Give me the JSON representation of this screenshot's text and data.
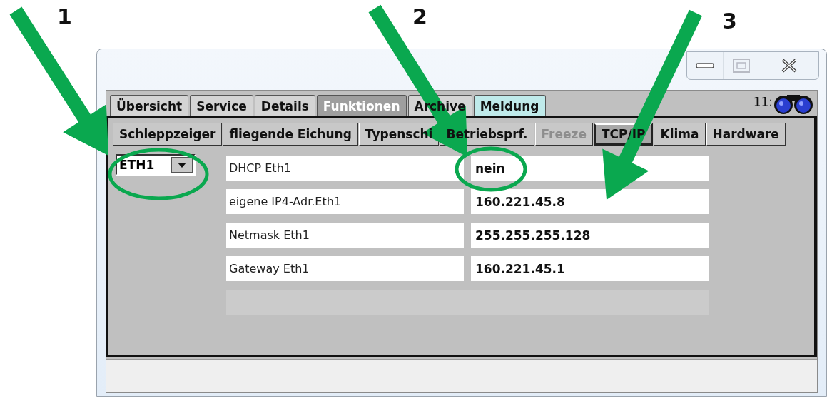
{
  "annotations": [
    {
      "label": "1"
    },
    {
      "label": "2"
    },
    {
      "label": "3"
    }
  ],
  "window": {
    "buttons": [
      {
        "kind": "minimize",
        "disabled": false
      },
      {
        "kind": "maximize",
        "disabled": true
      },
      {
        "kind": "close",
        "disabled": false
      }
    ]
  },
  "tabs": [
    {
      "label": "Übersicht",
      "selected": false,
      "highlighted": false
    },
    {
      "label": "Service",
      "selected": false,
      "highlighted": false
    },
    {
      "label": "Details",
      "selected": false,
      "highlighted": false
    },
    {
      "label": "Funktionen",
      "selected": true,
      "highlighted": false
    },
    {
      "label": "Archive",
      "selected": false,
      "highlighted": false
    },
    {
      "label": "Meldung",
      "selected": false,
      "highlighted": true
    }
  ],
  "clock": "11:",
  "subtabs": [
    {
      "label": "Schleppzeiger",
      "selected": false,
      "disabled": false
    },
    {
      "label": "fliegende Eichung",
      "selected": false,
      "disabled": false
    },
    {
      "label": "Typenschi",
      "selected": false,
      "disabled": false
    },
    {
      "label": "Betriebsprf.",
      "selected": false,
      "disabled": false
    },
    {
      "label": "Freeze",
      "selected": false,
      "disabled": true
    },
    {
      "label": "TCP/IP",
      "selected": true,
      "disabled": false
    },
    {
      "label": "Klima",
      "selected": false,
      "disabled": false
    },
    {
      "label": "Hardware",
      "selected": false,
      "disabled": false
    }
  ],
  "interface_select": {
    "value": "ETH1"
  },
  "rows": [
    {
      "label": "DHCP Eth1",
      "value": "nein"
    },
    {
      "label": "eigene IP4-Adr.Eth1",
      "value": "160.221.45.8"
    },
    {
      "label": "Netmask Eth1",
      "value": "255.255.255.128"
    },
    {
      "label": "Gateway Eth1",
      "value": "160.221.45.1"
    }
  ]
}
